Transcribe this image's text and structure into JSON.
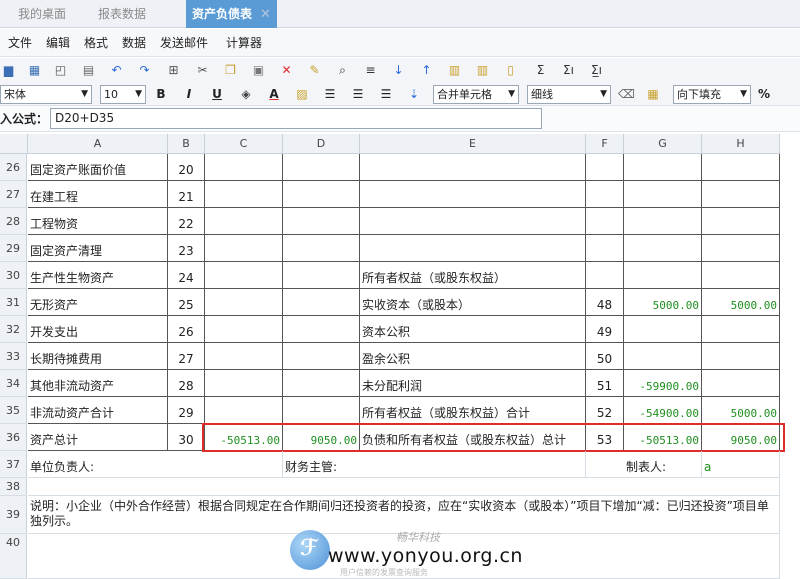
{
  "tabs": [
    {
      "label": "我的桌面",
      "active": false
    },
    {
      "label": "报表数据",
      "active": false
    },
    {
      "label": "资产负债表",
      "active": true,
      "close": "✕"
    }
  ],
  "menu": [
    "文件",
    "编辑",
    "格式",
    "数据",
    "发送邮件",
    "计算器"
  ],
  "toolbar": {
    "font_name": "宋体",
    "font_size": "10",
    "bold": "B",
    "italic": "I",
    "underline": "U",
    "font_color": "A",
    "merge": "合并单元格",
    "border": "细线",
    "fill": "向下填充",
    "percent": "%",
    "sum1": "Σ",
    "sum2": "Σı",
    "sum3": "Σ̲ı"
  },
  "formula": {
    "label": "入公式：",
    "value": "D20+D35"
  },
  "columns": [
    "A",
    "B",
    "C",
    "D",
    "E",
    "F",
    "G",
    "H"
  ],
  "rows": [
    {
      "num": "26",
      "a": "固定资产账面价值",
      "b": "20",
      "c": "",
      "d": "",
      "e": "",
      "f": "",
      "g": "",
      "h": ""
    },
    {
      "num": "27",
      "a": "在建工程",
      "b": "21",
      "c": "",
      "d": "",
      "e": "",
      "f": "",
      "g": "",
      "h": ""
    },
    {
      "num": "28",
      "a": "工程物资",
      "b": "22",
      "c": "",
      "d": "",
      "e": "",
      "f": "",
      "g": "",
      "h": ""
    },
    {
      "num": "29",
      "a": "固定资产清理",
      "b": "23",
      "c": "",
      "d": "",
      "e": "",
      "f": "",
      "g": "",
      "h": ""
    },
    {
      "num": "30",
      "a": "生产性生物资产",
      "b": "24",
      "c": "",
      "d": "",
      "e": "所有者权益（或股东权益）",
      "f": "",
      "g": "",
      "h": ""
    },
    {
      "num": "31",
      "a": "无形资产",
      "b": "25",
      "c": "",
      "d": "",
      "e": "实收资本（或股本）",
      "f": "48",
      "g": "5000.00",
      "h": "5000.00"
    },
    {
      "num": "32",
      "a": "开发支出",
      "b": "26",
      "c": "",
      "d": "",
      "e": "资本公积",
      "f": "49",
      "g": "",
      "h": ""
    },
    {
      "num": "33",
      "a": "长期待摊费用",
      "b": "27",
      "c": "",
      "d": "",
      "e": "盈余公积",
      "f": "50",
      "g": "",
      "h": ""
    },
    {
      "num": "34",
      "a": "其他非流动资产",
      "b": "28",
      "c": "",
      "d": "",
      "e": "未分配利润",
      "f": "51",
      "g": "-59900.00",
      "h": ""
    },
    {
      "num": "35",
      "a": "非流动资产合计",
      "b": "29",
      "c": "",
      "d": "",
      "e": "所有者权益（或股东权益）合计",
      "f": "52",
      "g": "-54900.00",
      "h": "5000.00"
    },
    {
      "num": "36",
      "a": "资产总计",
      "b": "30",
      "c": "-50513.00",
      "d": "9050.00",
      "e": "负债和所有者权益（或股东权益）总计",
      "f": "53",
      "g": "-50513.00",
      "h": "9050.00"
    }
  ],
  "row37": {
    "num": "37",
    "a": "单位负责人:",
    "d": "财务主管:",
    "f": "制表人:",
    "g": "a"
  },
  "row38": {
    "num": "38"
  },
  "row39": {
    "num": "39",
    "text": "说明：小企业（中外合作经营）根据合同规定在合作期间归还投资者的投资，应在“实收资本（或股本）”项目下增加“减：已归还投资”项目单独列示。"
  },
  "row40": {
    "num": "40"
  },
  "watermark": {
    "brand": "畅华科技",
    "url": "www.yonyou.org.cn",
    "tagline": "用户信赖的发票查询服务"
  }
}
